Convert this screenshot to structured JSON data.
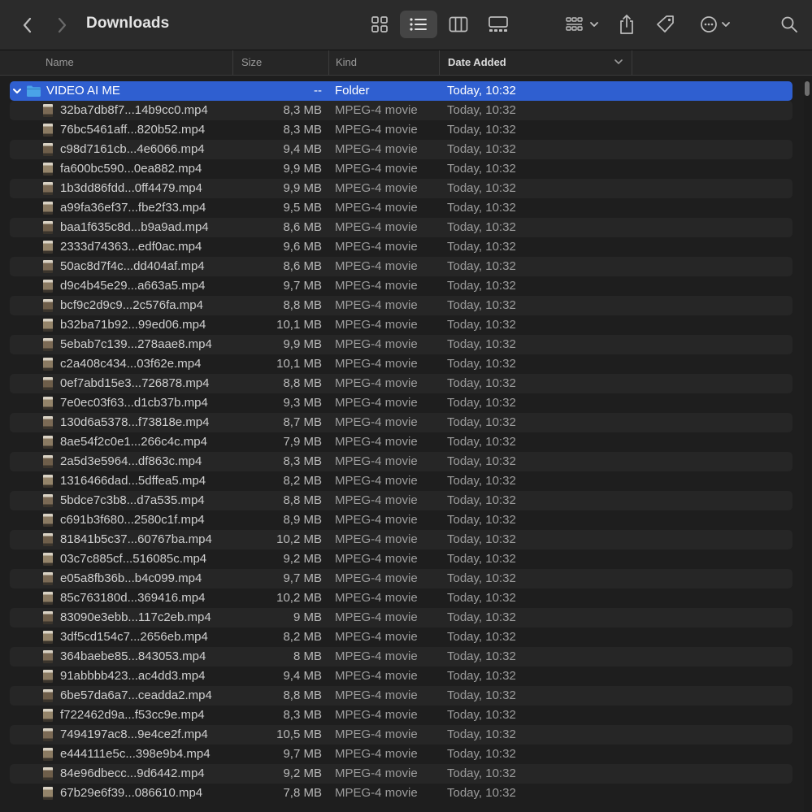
{
  "window": {
    "title": "Downloads"
  },
  "toolbar": {
    "back_icon": "chevron-left-icon",
    "forward_icon": "chevron-right-icon",
    "active_view": "list",
    "views": [
      "icon-grid",
      "list",
      "columns",
      "gallery"
    ]
  },
  "columns": {
    "name": "Name",
    "size": "Size",
    "kind": "Kind",
    "date_added": "Date Added",
    "sort_column": "Date Added",
    "sort_direction": "descending"
  },
  "colors": {
    "selection": "#2f5fd0",
    "folder": "#4aa3e8",
    "background": "#1e1e1e",
    "alt_row": "#262626"
  },
  "folder": {
    "name": "VIDEO AI ME",
    "size": "--",
    "kind": "Folder",
    "date": "Today, 10:32",
    "expanded": true,
    "selected": true
  },
  "files": [
    {
      "name": "32ba7db8f7...14b9cc0.mp4",
      "size": "8,3 MB",
      "kind": "MPEG-4 movie",
      "date": "Today, 10:32"
    },
    {
      "name": "76bc5461aff...820b52.mp4",
      "size": "8,3 MB",
      "kind": "MPEG-4 movie",
      "date": "Today, 10:32"
    },
    {
      "name": "c98d7161cb...4e6066.mp4",
      "size": "9,4 MB",
      "kind": "MPEG-4 movie",
      "date": "Today, 10:32"
    },
    {
      "name": "fa600bc590...0ea882.mp4",
      "size": "9,9 MB",
      "kind": "MPEG-4 movie",
      "date": "Today, 10:32"
    },
    {
      "name": "1b3dd86fdd...0ff4479.mp4",
      "size": "9,9 MB",
      "kind": "MPEG-4 movie",
      "date": "Today, 10:32"
    },
    {
      "name": "a99fa36ef37...fbe2f33.mp4",
      "size": "9,5 MB",
      "kind": "MPEG-4 movie",
      "date": "Today, 10:32"
    },
    {
      "name": "baa1f635c8d...b9a9ad.mp4",
      "size": "8,6 MB",
      "kind": "MPEG-4 movie",
      "date": "Today, 10:32"
    },
    {
      "name": "2333d74363...edf0ac.mp4",
      "size": "9,6 MB",
      "kind": "MPEG-4 movie",
      "date": "Today, 10:32"
    },
    {
      "name": "50ac8d7f4c...dd404af.mp4",
      "size": "8,6 MB",
      "kind": "MPEG-4 movie",
      "date": "Today, 10:32"
    },
    {
      "name": "d9c4b45e29...a663a5.mp4",
      "size": "9,7 MB",
      "kind": "MPEG-4 movie",
      "date": "Today, 10:32"
    },
    {
      "name": "bcf9c2d9c9...2c576fa.mp4",
      "size": "8,8 MB",
      "kind": "MPEG-4 movie",
      "date": "Today, 10:32"
    },
    {
      "name": "b32ba71b92...99ed06.mp4",
      "size": "10,1 MB",
      "kind": "MPEG-4 movie",
      "date": "Today, 10:32"
    },
    {
      "name": "5ebab7c139...278aae8.mp4",
      "size": "9,9 MB",
      "kind": "MPEG-4 movie",
      "date": "Today, 10:32"
    },
    {
      "name": "c2a408c434...03f62e.mp4",
      "size": "10,1 MB",
      "kind": "MPEG-4 movie",
      "date": "Today, 10:32"
    },
    {
      "name": "0ef7abd15e3...726878.mp4",
      "size": "8,8 MB",
      "kind": "MPEG-4 movie",
      "date": "Today, 10:32"
    },
    {
      "name": "7e0ec03f63...d1cb37b.mp4",
      "size": "9,3 MB",
      "kind": "MPEG-4 movie",
      "date": "Today, 10:32"
    },
    {
      "name": "130d6a5378...f73818e.mp4",
      "size": "8,7 MB",
      "kind": "MPEG-4 movie",
      "date": "Today, 10:32"
    },
    {
      "name": "8ae54f2c0e1...266c4c.mp4",
      "size": "7,9 MB",
      "kind": "MPEG-4 movie",
      "date": "Today, 10:32"
    },
    {
      "name": "2a5d3e5964...df863c.mp4",
      "size": "8,3 MB",
      "kind": "MPEG-4 movie",
      "date": "Today, 10:32"
    },
    {
      "name": "1316466dad...5dffea5.mp4",
      "size": "8,2 MB",
      "kind": "MPEG-4 movie",
      "date": "Today, 10:32"
    },
    {
      "name": "5bdce7c3b8...d7a535.mp4",
      "size": "8,8 MB",
      "kind": "MPEG-4 movie",
      "date": "Today, 10:32"
    },
    {
      "name": "c691b3f680...2580c1f.mp4",
      "size": "8,9 MB",
      "kind": "MPEG-4 movie",
      "date": "Today, 10:32"
    },
    {
      "name": "81841b5c37...60767ba.mp4",
      "size": "10,2 MB",
      "kind": "MPEG-4 movie",
      "date": "Today, 10:32"
    },
    {
      "name": "03c7c885cf...516085c.mp4",
      "size": "9,2 MB",
      "kind": "MPEG-4 movie",
      "date": "Today, 10:32"
    },
    {
      "name": "e05a8fb36b...b4c099.mp4",
      "size": "9,7 MB",
      "kind": "MPEG-4 movie",
      "date": "Today, 10:32"
    },
    {
      "name": "85c763180d...369416.mp4",
      "size": "10,2 MB",
      "kind": "MPEG-4 movie",
      "date": "Today, 10:32"
    },
    {
      "name": "83090e3ebb...117c2eb.mp4",
      "size": "9 MB",
      "kind": "MPEG-4 movie",
      "date": "Today, 10:32"
    },
    {
      "name": "3df5cd154c7...2656eb.mp4",
      "size": "8,2 MB",
      "kind": "MPEG-4 movie",
      "date": "Today, 10:32"
    },
    {
      "name": "364baebe85...843053.mp4",
      "size": "8 MB",
      "kind": "MPEG-4 movie",
      "date": "Today, 10:32"
    },
    {
      "name": "91abbbb423...ac4dd3.mp4",
      "size": "9,4 MB",
      "kind": "MPEG-4 movie",
      "date": "Today, 10:32"
    },
    {
      "name": "6be57da6a7...ceadda2.mp4",
      "size": "8,8 MB",
      "kind": "MPEG-4 movie",
      "date": "Today, 10:32"
    },
    {
      "name": "f722462d9a...f53cc9e.mp4",
      "size": "8,3 MB",
      "kind": "MPEG-4 movie",
      "date": "Today, 10:32"
    },
    {
      "name": "7494197ac8...9e4ce2f.mp4",
      "size": "10,5 MB",
      "kind": "MPEG-4 movie",
      "date": "Today, 10:32"
    },
    {
      "name": "e444111e5c...398e9b4.mp4",
      "size": "9,7 MB",
      "kind": "MPEG-4 movie",
      "date": "Today, 10:32"
    },
    {
      "name": "84e96dbecc...9d6442.mp4",
      "size": "9,2 MB",
      "kind": "MPEG-4 movie",
      "date": "Today, 10:32"
    },
    {
      "name": "67b29e6f39...086610.mp4",
      "size": "7,8 MB",
      "kind": "MPEG-4 movie",
      "date": "Today, 10:32"
    }
  ]
}
